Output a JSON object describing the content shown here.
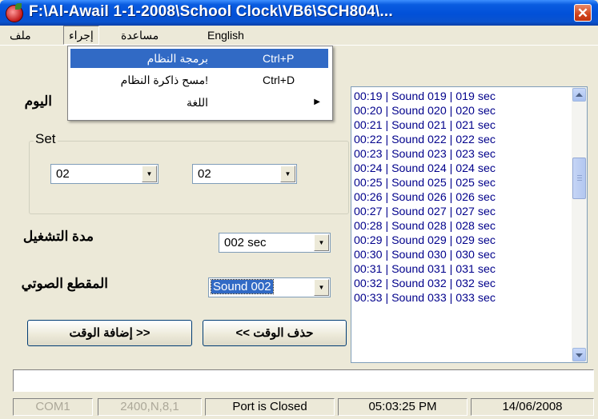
{
  "window": {
    "title": "F:\\Al-Awail 1-1-2008\\School Clock\\VB6\\SCH804\\...",
    "close_glyph": "✕",
    "app_icon": "speaker-apple-icon"
  },
  "menu": {
    "items": [
      "ملف",
      "إجراء",
      "مساعدة",
      "English"
    ]
  },
  "dropdown": {
    "items": [
      {
        "label": "برمجة النظام",
        "shortcut": "Ctrl+P",
        "selected": true
      },
      {
        "label": "!مسح ذاكرة النظام",
        "shortcut": "Ctrl+D"
      },
      {
        "label": "اللغة",
        "submenu_glyph": "▶"
      }
    ]
  },
  "form": {
    "day_label": "اليوم",
    "group_label": "Set",
    "combo_1": "02",
    "combo_2": "02",
    "duration_label": "مدة التشغيل",
    "duration_value": "002 sec",
    "sound_label": "المقطع الصوتي",
    "sound_value": "Sound 002",
    "add_button": "<< إضافة الوقت",
    "delete_button": "حذف الوقت >>"
  },
  "list": {
    "rows": [
      "00:19 | Sound 019 | 019 sec",
      "00:20 | Sound 020 | 020 sec",
      "00:21 | Sound 021 | 021 sec",
      "00:22 | Sound 022 | 022 sec",
      "00:23 | Sound 023 | 023 sec",
      "00:24 | Sound 024 | 024 sec",
      "00:25 | Sound 025 | 025 sec",
      "00:26 | Sound 026 | 026 sec",
      "00:27 | Sound 027 | 027 sec",
      "00:28 | Sound 028 | 028 sec",
      "00:29 | Sound 029 | 029 sec",
      "00:30 | Sound 030 | 030 sec",
      "00:31 | Sound 031 | 031 sec",
      "00:32 | Sound 032 | 032 sec",
      "00:33 | Sound 033 | 033 sec"
    ]
  },
  "status": {
    "port": "COM1",
    "settings": "2400,N,8,1",
    "state": "Port is Closed",
    "time": "05:03:25 PM",
    "date": "14/06/2008"
  },
  "colors": {
    "title_blue": "#0150d8",
    "selection": "#316ac5",
    "close_red": "#d2431a"
  }
}
